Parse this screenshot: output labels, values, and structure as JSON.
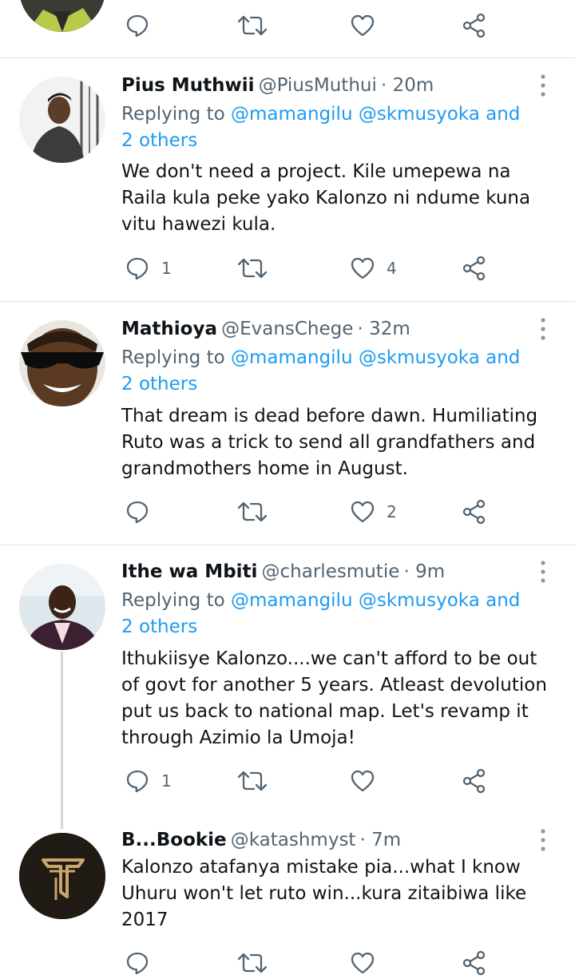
{
  "colors": {
    "link": "#1d9bf0",
    "muted": "#536471",
    "text": "#0f1419",
    "divider": "#dfe3e6"
  },
  "tweets": [
    {
      "name": "Pius Muthwii",
      "handle": "@PiusMuthui",
      "time": "· 20m",
      "replying_prefix": "Replying to ",
      "replying_mentions": "@mamangilu @skmusyoka and 2 others",
      "text": "We don't need a project. Kile umepewa na Raila kula peke yako Kalonzo ni ndume kuna vitu hawezi kula.",
      "reply_count": "1",
      "like_count": "4"
    },
    {
      "name": "Mathioya",
      "handle": "@EvansChege",
      "time": "· 32m",
      "replying_prefix": "Replying to ",
      "replying_mentions": "@mamangilu @skmusyoka and 2 others",
      "text": "That dream is dead before dawn. Humiliating Ruto was a trick to send all grandfathers and grandmothers home in August.",
      "reply_count": "",
      "like_count": "2"
    },
    {
      "name": "Ithe wa Mbiti",
      "handle": "@charlesmutie",
      "time": "· 9m",
      "replying_prefix": "Replying to ",
      "replying_mentions": "@mamangilu @skmusyoka and 2 others",
      "text": "Ithukiisye Kalonzo....we can't afford to be out of govt for another 5 years. Atleast devolution put us back to national map. Let's revamp it through Azimio la Umoja!",
      "reply_count": "1",
      "like_count": ""
    },
    {
      "name": "B...Bookie",
      "handle": "@katashmyst",
      "time": "· 7m",
      "text": "Kalonzo atafanya mistake pia...what I know Uhuru won't let ruto win...kura zitaibiwa like 2017",
      "reply_count": "",
      "like_count": ""
    }
  ],
  "icons": [
    "reply-icon",
    "retweet-icon",
    "like-icon",
    "share-icon",
    "more-icon"
  ]
}
